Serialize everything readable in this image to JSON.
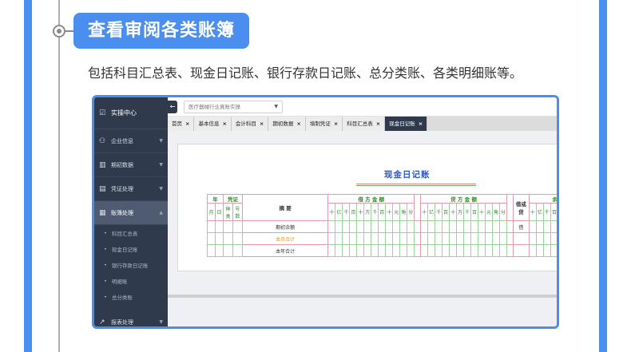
{
  "header": {
    "title": "查看审阅各类账簿",
    "subtitle": "包括科目汇总表、现金日记账、银行存款日记账、总分类账、各类明细账等。"
  },
  "colors": {
    "accent": "#4a8ef0",
    "sidebar": "#2f3a4c",
    "title_blue": "#2b55c7"
  },
  "app": {
    "sidebar": {
      "head": "实操中心",
      "items": [
        {
          "label": "企业信息",
          "icon": "company-icon"
        },
        {
          "label": "期初数据",
          "icon": "bar-chart-icon"
        },
        {
          "label": "凭证处理",
          "icon": "voucher-icon"
        },
        {
          "label": "账簿处理",
          "icon": "ledger-icon"
        }
      ],
      "sub_items": [
        "科目汇总表",
        "现金日记账",
        "银行存款日记账",
        "明细账",
        "总分类账"
      ],
      "bottom_item": {
        "label": "报表处理",
        "icon": "line-chart-icon"
      }
    },
    "company": "医疗器械行业真账实操",
    "tabs": [
      {
        "label": "首页"
      },
      {
        "label": "基本信息"
      },
      {
        "label": "会计科目"
      },
      {
        "label": "期初数据"
      },
      {
        "label": "填制凭证"
      },
      {
        "label": "科目汇总表"
      },
      {
        "label": "现金日记账"
      }
    ],
    "ledger": {
      "title": "现金日记账",
      "h_year": "年",
      "h_voucher": "凭证",
      "h_summary": "摘  要",
      "h_debit": "借 方 金 额",
      "h_credit": "贷 方 金 额",
      "h_dir": "借或贷",
      "h_balance_part": "余",
      "h_month": "月",
      "h_day": "日",
      "h_type": "种类",
      "h_number": "号数",
      "digits": [
        "十",
        "亿",
        "千",
        "百",
        "十",
        "万",
        "千",
        "百",
        "十",
        "元",
        "角",
        "分"
      ],
      "rows": [
        {
          "summary": "期初余额",
          "dir": "借"
        },
        {
          "summary": "本月合计",
          "dir": ""
        },
        {
          "summary": "本年合计",
          "dir": ""
        }
      ]
    }
  }
}
